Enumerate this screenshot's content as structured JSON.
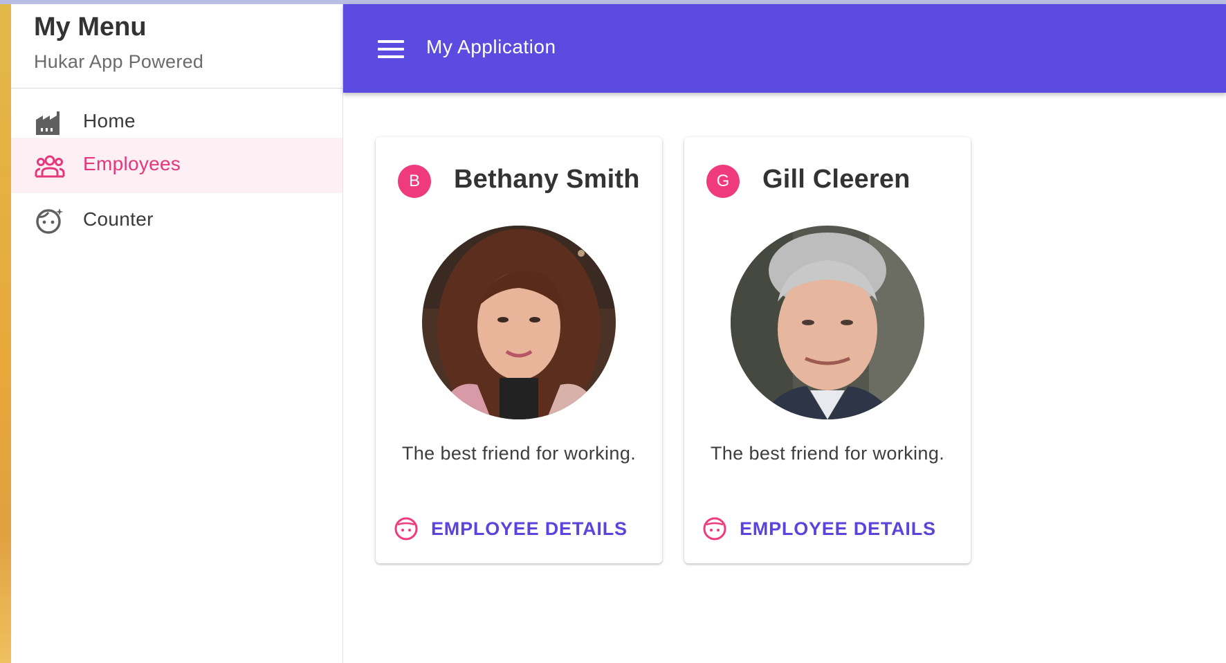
{
  "sidebar": {
    "title": "My Menu",
    "subtitle": "Hukar App Powered",
    "items": [
      {
        "label": "Home",
        "icon": "factory-icon",
        "active": false
      },
      {
        "label": "Employees",
        "icon": "people-icon",
        "active": true
      },
      {
        "label": "Counter",
        "icon": "face-icon",
        "active": false
      }
    ]
  },
  "appbar": {
    "title": "My Application",
    "menu_icon": "hamburger-menu-icon",
    "color": "#5b4be0"
  },
  "employees": [
    {
      "initial": "B",
      "name": "Bethany Smith",
      "description": "The best friend for working.",
      "action_label": "EMPLOYEE DETAILS",
      "action_icon": "face-icon"
    },
    {
      "initial": "G",
      "name": "Gill Cleeren",
      "description": "The best friend for working.",
      "action_label": "EMPLOYEE DETAILS",
      "action_icon": "face-icon"
    }
  ],
  "colors": {
    "accent_pink": "#ef3b7e",
    "active_bg": "#fdf0f4",
    "primary": "#5b4be0",
    "action_text": "#5b44dc"
  }
}
